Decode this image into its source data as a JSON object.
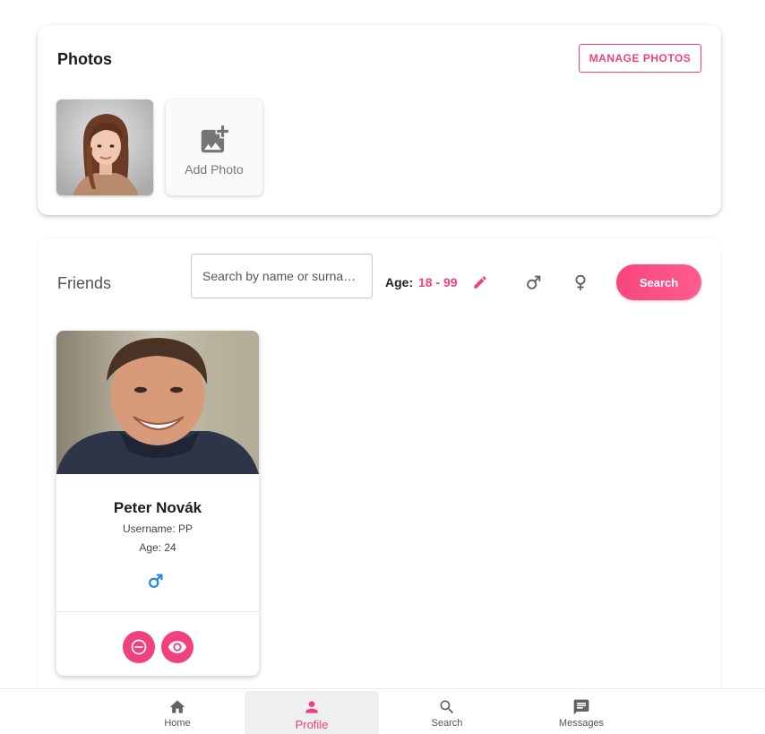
{
  "photos": {
    "title": "Photos",
    "manage_label": "MANAGE PHOTOS",
    "add_photo_label": "Add Photo"
  },
  "friends": {
    "title": "Friends",
    "search_placeholder": "Search by name or surna…",
    "age_label": "Age:",
    "age_range": "18 - 99",
    "search_button": "Search",
    "list": [
      {
        "name": "Peter Novák",
        "username": "Username: PP",
        "age": "Age: 24",
        "gender": "male"
      }
    ]
  },
  "nav": {
    "items": [
      {
        "label": "Home",
        "icon": "home-icon"
      },
      {
        "label": "Profile",
        "icon": "person-icon",
        "active": true
      },
      {
        "label": "Search",
        "icon": "search-icon"
      },
      {
        "label": "Messages",
        "icon": "message-icon"
      }
    ]
  },
  "colors": {
    "accent": "#f0417e",
    "male": "#1e88e5",
    "icon_gray": "#616161"
  }
}
